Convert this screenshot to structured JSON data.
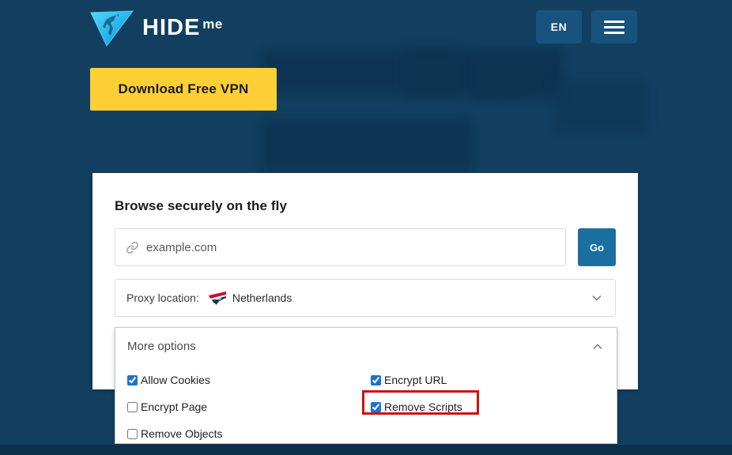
{
  "header": {
    "brand": {
      "logo_icon": "hideme-triangle-logo",
      "name_primary": "HIDE",
      "name_secondary": "me"
    },
    "language_button": {
      "label": "EN"
    },
    "menu_button": {
      "icon": "hamburger-menu-icon",
      "label": ""
    }
  },
  "hero": {
    "download_button_label": "Download Free VPN"
  },
  "card": {
    "title": "Browse securely on the fly",
    "url_field": {
      "icon": "link-icon",
      "value": "",
      "placeholder": "example.com"
    },
    "go_button_label": "Go",
    "proxy_location": {
      "label": "Proxy location:",
      "flag_icon": "netherlands-flag-icon",
      "value": "Netherlands",
      "chevron_icon": "chevron-down-icon"
    }
  },
  "more_options": {
    "label": "More options",
    "chevron_icon": "chevron-up-icon",
    "expanded": true,
    "options": [
      {
        "id": "allow-cookies",
        "label": "Allow Cookies",
        "checked": true,
        "column": "left"
      },
      {
        "id": "encrypt-url",
        "label": "Encrypt URL",
        "checked": true,
        "column": "right"
      },
      {
        "id": "encrypt-page",
        "label": "Encrypt Page",
        "checked": false,
        "column": "left"
      },
      {
        "id": "remove-scripts",
        "label": "Remove Scripts",
        "checked": true,
        "column": "right"
      },
      {
        "id": "remove-objects",
        "label": "Remove Objects",
        "checked": false,
        "column": "left"
      }
    ]
  },
  "annotation": {
    "highlight_target": "Remove Scripts",
    "highlight_color": "#cc1212"
  },
  "colors": {
    "page_background": "#123f60",
    "header_button": "#17537c",
    "cta_yellow": "#fcd034",
    "go_blue": "#1b6ea0",
    "logo_cyan": "#35c6f4",
    "card_white": "#ffffff"
  }
}
